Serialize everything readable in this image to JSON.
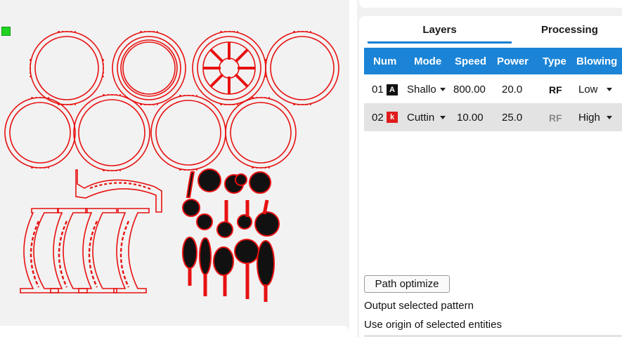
{
  "tabs": [
    {
      "label": "Layers",
      "active": true
    },
    {
      "label": "Processing",
      "active": false
    }
  ],
  "table": {
    "headers": [
      "Num",
      "Mode",
      "Speed",
      "Power",
      "Type",
      "Blowing"
    ],
    "rows": [
      {
        "num": "01",
        "badge": "A",
        "badge_color": "#111111",
        "mode": "Shallo",
        "speed": "800.00",
        "power": "20.0",
        "type": "RF",
        "type_state": "active",
        "blowing": "Low"
      },
      {
        "num": "02",
        "badge": "k",
        "badge_color": "#e01b1b",
        "mode": "Cuttin",
        "speed": "10.00",
        "power": "25.0",
        "type": "RF",
        "type_state": "dimmed",
        "blowing": "High"
      }
    ]
  },
  "actions": {
    "path_optimize": "Path optimize",
    "output_selected": "Output selected pattern",
    "use_origin": "Use origin of selected entities"
  },
  "colors": {
    "accent": "#1b84d6",
    "cut_line": "#e81010",
    "origin_marker": "#21d421"
  },
  "icons": {
    "origin": "origin-marker-icon",
    "dropdown": "chevron-down-icon"
  }
}
